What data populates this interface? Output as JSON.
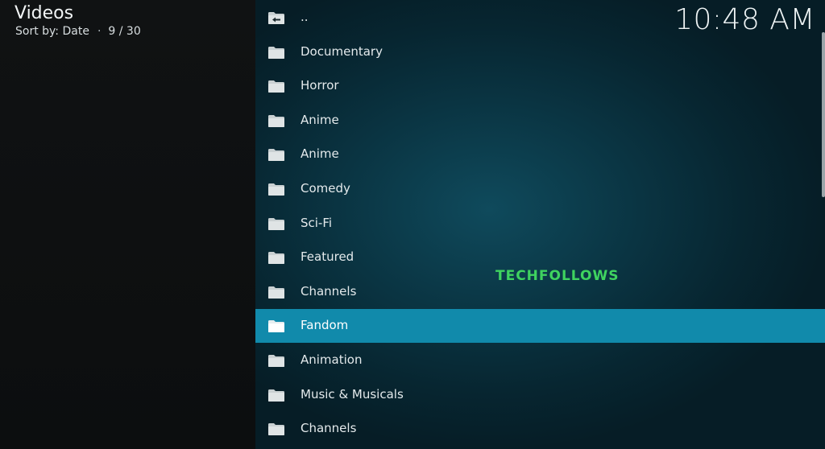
{
  "header": {
    "title": "Videos",
    "sort_label": "Sort by: Date",
    "separator": "·",
    "position": "9 / 30"
  },
  "clock": {
    "time": "10:48 AM"
  },
  "watermark": {
    "text": "TECHFOLLOWS"
  },
  "list": {
    "selected_index": 9,
    "items": [
      {
        "label": "..",
        "icon": "back-folder-icon"
      },
      {
        "label": "Documentary",
        "icon": "folder-icon"
      },
      {
        "label": "Horror",
        "icon": "folder-icon"
      },
      {
        "label": "Anime",
        "icon": "folder-icon"
      },
      {
        "label": "Anime",
        "icon": "folder-icon"
      },
      {
        "label": "Comedy",
        "icon": "folder-icon"
      },
      {
        "label": "Sci-Fi",
        "icon": "folder-icon"
      },
      {
        "label": "Featured",
        "icon": "folder-icon"
      },
      {
        "label": "Channels",
        "icon": "folder-icon"
      },
      {
        "label": "Fandom",
        "icon": "folder-open-icon"
      },
      {
        "label": "Animation",
        "icon": "folder-icon"
      },
      {
        "label": "Music & Musicals",
        "icon": "folder-icon"
      },
      {
        "label": "Channels",
        "icon": "folder-icon"
      }
    ]
  },
  "colors": {
    "selected_row": "#118aab",
    "watermark": "#3fd35f",
    "background_left": "#0e1011",
    "background_right": "#0a3442"
  }
}
